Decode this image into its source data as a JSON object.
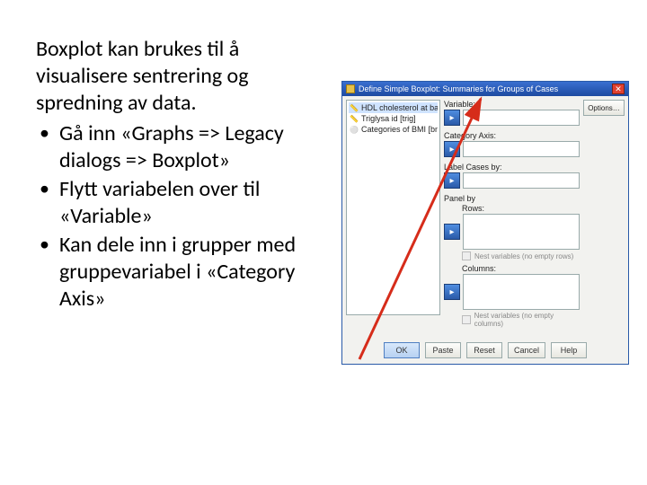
{
  "text": {
    "intro": "Boxplot kan brukes til å visualisere sentrering og spredning av data.",
    "bullet1": "Gå inn «Graphs => Legacy dialogs => Boxplot»",
    "bullet2": "Flytt variabelen over til «Variable»",
    "bullet3": "Kan dele inn i grupper med gruppevariabel i «Category Axis»"
  },
  "dialog": {
    "title": "Define Simple Boxplot: Summaries for Groups of Cases",
    "vars": {
      "v1": "HDL cholesterol at bas…",
      "v2": "Triglysa id [trig]",
      "v3": "Categories of BMI [bm…"
    },
    "labels": {
      "variable": "Variable:",
      "category": "Category Axis:",
      "labelby": "Label Cases by:",
      "panelby": "Panel by",
      "rows": "Rows:",
      "columns": "Columns:",
      "nestrows": "Nest variables (no empty rows)",
      "nestcols": "Nest variables (no empty columns)"
    },
    "side": {
      "options": "Options…"
    },
    "buttons": {
      "ok": "OK",
      "paste": "Paste",
      "reset": "Reset",
      "cancel": "Cancel",
      "help": "Help"
    }
  }
}
